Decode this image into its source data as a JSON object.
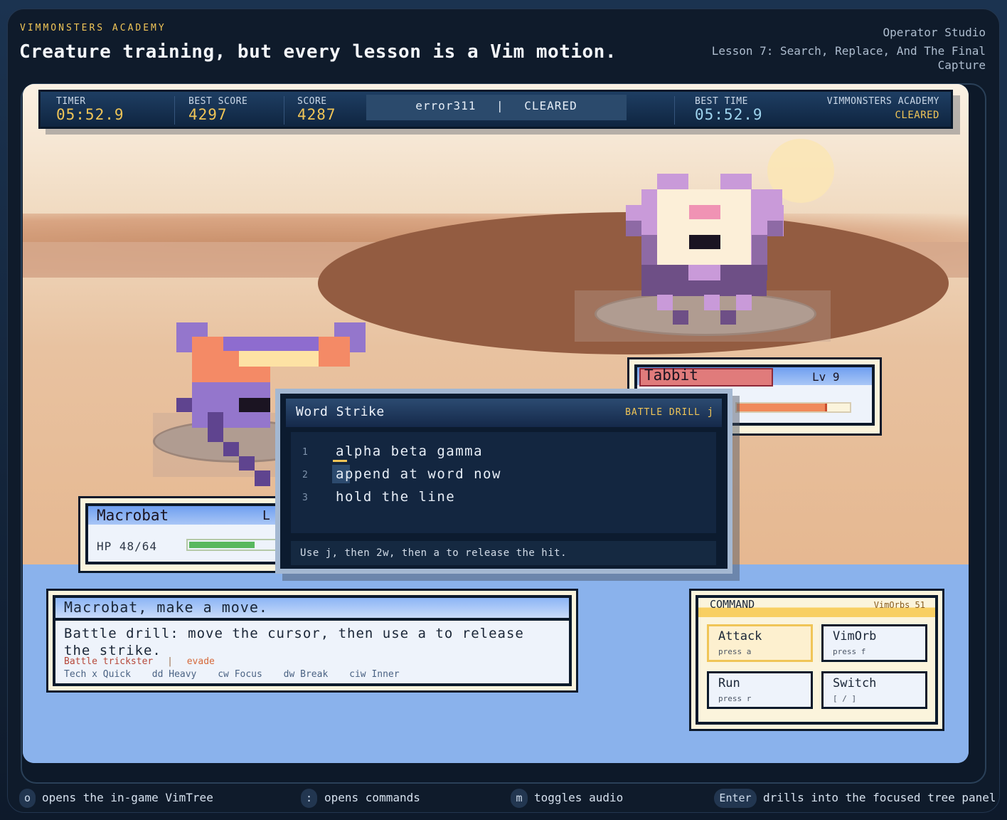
{
  "header": {
    "eyebrow": "VIMMONSTERS ACADEMY",
    "headline": "Creature training, but every lesson is a Vim motion.",
    "studio": "Operator Studio",
    "lesson": "Lesson 7: Search, Replace, And The Final Capture"
  },
  "hud": {
    "timer_label": "TIMER",
    "timer_value": "05:52.9",
    "best_score_label": "BEST SCORE",
    "best_score_value": "4297",
    "score_label": "SCORE",
    "score_value": "4287",
    "player": "error311",
    "separator": "|",
    "status": "CLEARED",
    "best_time_label": "BEST TIME",
    "best_time_value": "05:52.9",
    "academy_label": "VIMMONSTERS ACADEMY",
    "academy_status": "CLEARED"
  },
  "enemy": {
    "name": "Tabbit",
    "level": "Lv 9",
    "hp_fraction": 0.8
  },
  "player_creature": {
    "name": "Macrobat",
    "level_glyph": "L",
    "hp_text": "HP 48/64",
    "hp_fraction": 0.75
  },
  "editor": {
    "title": "Word Strike",
    "tag": "BATTLE DRILL",
    "key": "j",
    "lines": [
      {
        "num": "1",
        "text": "alpha beta gamma"
      },
      {
        "num": "2",
        "text": "append at word now"
      },
      {
        "num": "3",
        "text": "hold the line"
      }
    ],
    "hint": "Use j, then 2w, then a to release the hit."
  },
  "message": {
    "title": "Macrobat, make a move.",
    "body": "Battle drill: move the cursor, then use a to release the strike.",
    "trait_name": "Battle trickster",
    "trait_sep": "|",
    "trait_move": "evade",
    "moves": [
      {
        "key": "Tech x",
        "name": "Quick"
      },
      {
        "key": "dd",
        "name": "Heavy"
      },
      {
        "key": "cw",
        "name": "Focus"
      },
      {
        "key": "dw",
        "name": "Break"
      },
      {
        "key": "ciw",
        "name": "Inner"
      }
    ]
  },
  "command": {
    "title": "COMMAND",
    "orbs": "VimOrbs 51",
    "buttons": [
      {
        "label": "Attack",
        "key": "press a"
      },
      {
        "label": "VimOrb",
        "key": "press f"
      },
      {
        "label": "Run",
        "key": "press r"
      },
      {
        "label": "Switch",
        "key": "[ / ]"
      }
    ]
  },
  "footer": [
    {
      "key": "o",
      "text": "opens the in-game VimTree"
    },
    {
      "key": ":",
      "text": "opens commands"
    },
    {
      "key": "m",
      "text": "toggles audio"
    },
    {
      "key": "Enter",
      "text": "drills into the focused tree panel"
    }
  ],
  "colors": {
    "accent_gold": "#f0c557",
    "hud_navy": "#15294a",
    "enemy_hp": "#f08a5b",
    "player_hp": "#58b85e",
    "enemy_name_bg": "#e07b7b",
    "field_blue": "#8ab2ec"
  }
}
